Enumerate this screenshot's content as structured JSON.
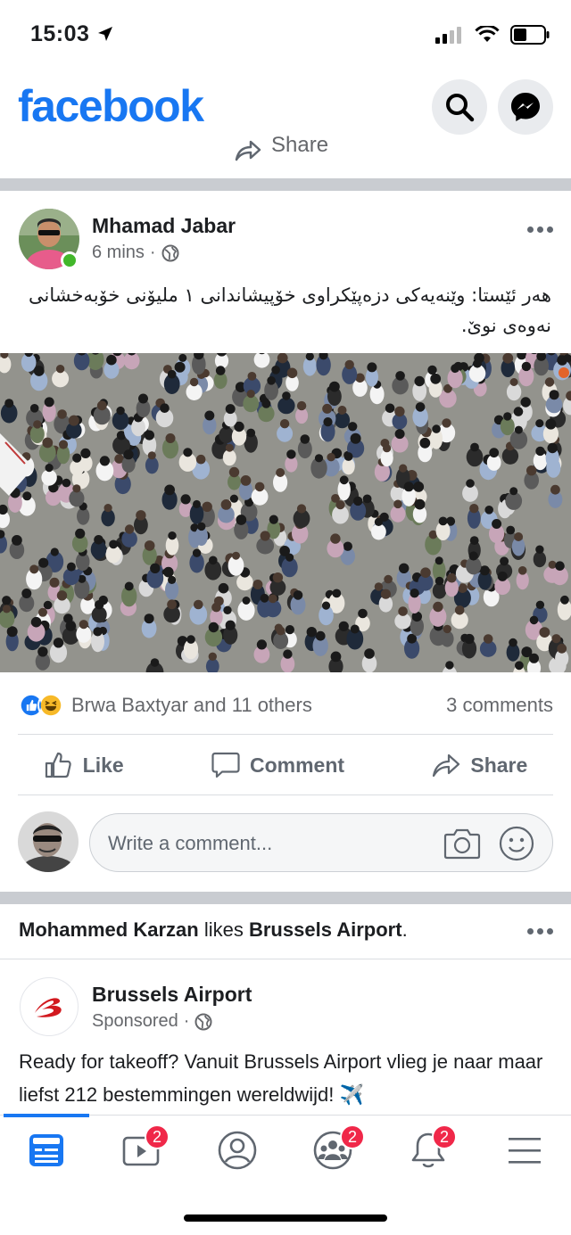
{
  "status_bar": {
    "time": "15:03"
  },
  "header": {
    "logo": "facebook",
    "search_icon": "search-icon",
    "messenger_icon": "messenger-icon"
  },
  "prev_post": {
    "share_label": "Share"
  },
  "post": {
    "author": "Mhamad Jabar",
    "time": "6 mins",
    "meta_sep": "·",
    "privacy_icon": "globe-icon",
    "text": "هەر ئێستا: وێنەیەکی دزەپێکراوی خۆپیشاندانی ١ ملیۆنی خۆبەخشانی نەوەی نوێ.",
    "reactions_text": "Brwa Baxtyar and 11 others",
    "comments_count": "3 comments",
    "actions": {
      "like": "Like",
      "comment": "Comment",
      "share": "Share"
    },
    "comment_placeholder": "Write a comment..."
  },
  "story": {
    "actor": "Mohammed Karzan",
    "verb": "likes",
    "page": "Brussels Airport",
    "end": "."
  },
  "ad": {
    "name": "Brussels Airport",
    "label": "Sponsored",
    "meta_sep": "·",
    "text": "Ready for takeoff? Vanuit Brussels Airport vlieg je naar maar liefst 212 bestemmingen wereldwijd! ✈️"
  },
  "tabbar": {
    "tabs": [
      {
        "name": "news-feed",
        "icon": "news-feed-icon",
        "badge": ""
      },
      {
        "name": "watch",
        "icon": "watch-icon",
        "badge": "2"
      },
      {
        "name": "profile",
        "icon": "profile-icon",
        "badge": ""
      },
      {
        "name": "groups",
        "icon": "groups-icon",
        "badge": "2"
      },
      {
        "name": "notifications",
        "icon": "bell-icon",
        "badge": "2"
      },
      {
        "name": "menu",
        "icon": "menu-icon",
        "badge": ""
      }
    ]
  },
  "colors": {
    "brand": "#1877f2",
    "badge": "#f02849",
    "divider": "#c9ccd1",
    "online": "#42b72a"
  }
}
